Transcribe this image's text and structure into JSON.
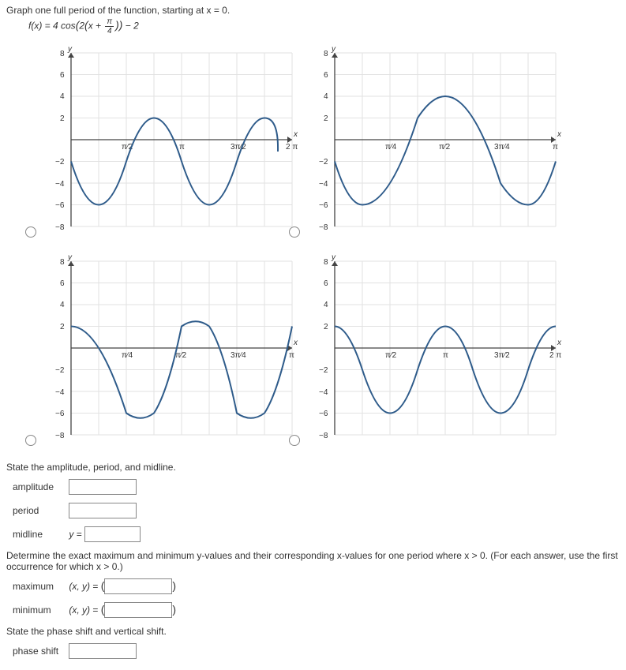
{
  "q1": "Graph one full period of the function, starting at x = 0.",
  "formula_left": "f(x) = 4 cos",
  "formula_inside_pre": "2",
  "formula_inside_post": "x + ",
  "formula_frac_t": "π",
  "formula_frac_b": "4",
  "formula_tail": " − 2",
  "axis_y": "y",
  "axis_x": "x",
  "yticks": [
    "8",
    "6",
    "4",
    "2",
    "−2",
    "−4",
    "−6",
    "−8"
  ],
  "graphA_x": [
    "π⁄2",
    "π",
    "3π⁄2",
    "2 π"
  ],
  "graphB_x": [
    "π⁄4",
    "π⁄2",
    "3π⁄4",
    "π"
  ],
  "graphC_x": [
    "π⁄4",
    "π⁄2",
    "3π⁄4",
    "π"
  ],
  "graphD_x": [
    "π⁄2",
    "π",
    "3π⁄2",
    "2 π"
  ],
  "sec2": "State the amplitude, period, and midline.",
  "lbl_amp": "amplitude",
  "lbl_per": "period",
  "lbl_mid": "midline",
  "mid_prefix": "y =",
  "sec3": "Determine the exact maximum and minimum y-values and their corresponding x-values for one period where x > 0. (For each answer, use the first occurrence for which x > 0.)",
  "lbl_max": "maximum",
  "lbl_min": "minimum",
  "xy_prefix": "(x, y) = ",
  "sec4": "State the phase shift and vertical shift.",
  "lbl_phase": "phase shift",
  "chart_data": [
    {
      "type": "line",
      "title": "Option A",
      "xlabel": "x",
      "ylabel": "y",
      "xlim": [
        0,
        "2π"
      ],
      "ylim": [
        -8,
        8
      ],
      "function": "4cos(2(x+π/4))-2",
      "points": [
        [
          0,
          -2
        ],
        [
          "π/4",
          -6
        ],
        [
          "π/2",
          -2
        ],
        [
          "3π/4",
          2
        ],
        [
          "π",
          -2
        ],
        [
          "5π/4",
          -6
        ],
        [
          "3π/2",
          -2
        ],
        [
          "7π/4",
          2
        ],
        [
          "2π",
          -2
        ]
      ],
      "orientation_note": "starts at -2 going down (−sin-like)"
    },
    {
      "type": "line",
      "title": "Option B",
      "xlabel": "x",
      "ylabel": "y",
      "xlim": [
        0,
        "π"
      ],
      "ylim": [
        -8,
        8
      ],
      "points": [
        [
          0,
          -2
        ],
        [
          "π/8",
          -6
        ],
        [
          "π/4",
          -2
        ],
        [
          "3π/8",
          2
        ],
        [
          "π/2",
          4
        ],
        [
          "5π/8",
          2
        ],
        [
          "3π/4",
          -2
        ],
        [
          "7π/8",
          -6
        ],
        [
          "π",
          -2
        ]
      ]
    },
    {
      "type": "line",
      "title": "Option C",
      "xlabel": "x",
      "ylabel": "y",
      "xlim": [
        0,
        "π"
      ],
      "ylim": [
        -8,
        8
      ],
      "points": [
        [
          0,
          2
        ],
        [
          "π/8",
          -2
        ],
        [
          "π/4",
          -6
        ],
        [
          "3π/8",
          -2
        ],
        [
          "π/2",
          2
        ],
        [
          "5π/8",
          -2
        ],
        [
          "3π/4",
          -6
        ],
        [
          "7π/8",
          -2
        ],
        [
          "π",
          2
        ]
      ]
    },
    {
      "type": "line",
      "title": "Option D",
      "xlabel": "x",
      "ylabel": "y",
      "xlim": [
        0,
        "2π"
      ],
      "ylim": [
        -8,
        8
      ],
      "points": [
        [
          0,
          2
        ],
        [
          "π/4",
          -2
        ],
        [
          "π/2",
          -6
        ],
        [
          "3π/4",
          -2
        ],
        [
          "π",
          2
        ],
        [
          "5π/4",
          -2
        ],
        [
          "3π/2",
          -6
        ],
        [
          "7π/4",
          -2
        ],
        [
          "2π",
          2
        ]
      ]
    }
  ]
}
